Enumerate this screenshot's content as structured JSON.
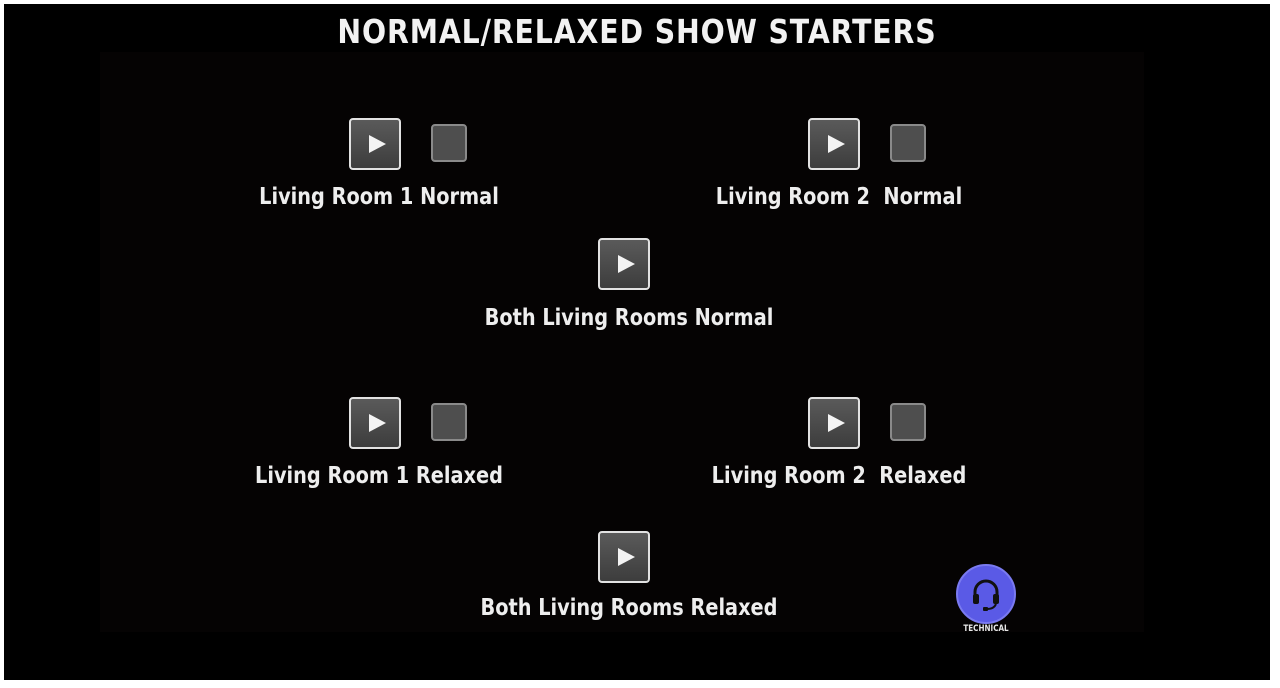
{
  "title": "NORMAL/RELAXED SHOW STARTERS",
  "starters": {
    "lr1_normal": {
      "label": "Living Room 1 Normal"
    },
    "lr2_normal": {
      "label": "Living Room 2  Normal"
    },
    "both_normal": {
      "label": "Both Living Rooms Normal"
    },
    "lr1_relaxed": {
      "label": "Living Room 1 Relaxed"
    },
    "lr2_relaxed": {
      "label": "Living Room 2  Relaxed"
    },
    "both_relaxed": {
      "label": "Both Living Rooms Relaxed"
    }
  },
  "technical": {
    "label": "TECHNICAL",
    "icon": "headset-icon"
  },
  "icons": {
    "play": "play-icon"
  },
  "colors": {
    "background": "#000000",
    "button_fill": "#4a4a4a",
    "button_border": "#e2e2e2",
    "status_fill": "#4e4e4e",
    "text": "#eeeeee",
    "technical_accent": "#5a5ae6"
  }
}
